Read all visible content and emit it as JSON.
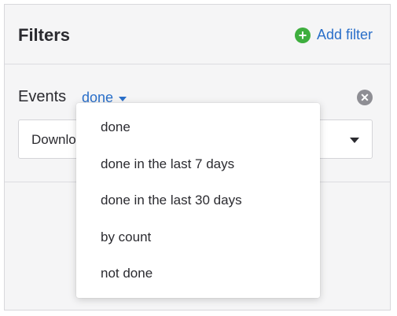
{
  "header": {
    "title": "Filters",
    "add_filter_label": "Add filter",
    "add_filter_icon": "plus-circle-icon"
  },
  "filter": {
    "label": "Events",
    "mode": "done",
    "select_value": "Download",
    "remove_icon": "close-circle-icon"
  },
  "dropdown": {
    "options": [
      "done",
      "done in the last 7 days",
      "done in the last 30 days",
      "by count",
      "not done"
    ]
  },
  "colors": {
    "accent": "#2a6fc9",
    "add_icon": "#3eae3e",
    "panel_bg": "#f5f5f6"
  }
}
